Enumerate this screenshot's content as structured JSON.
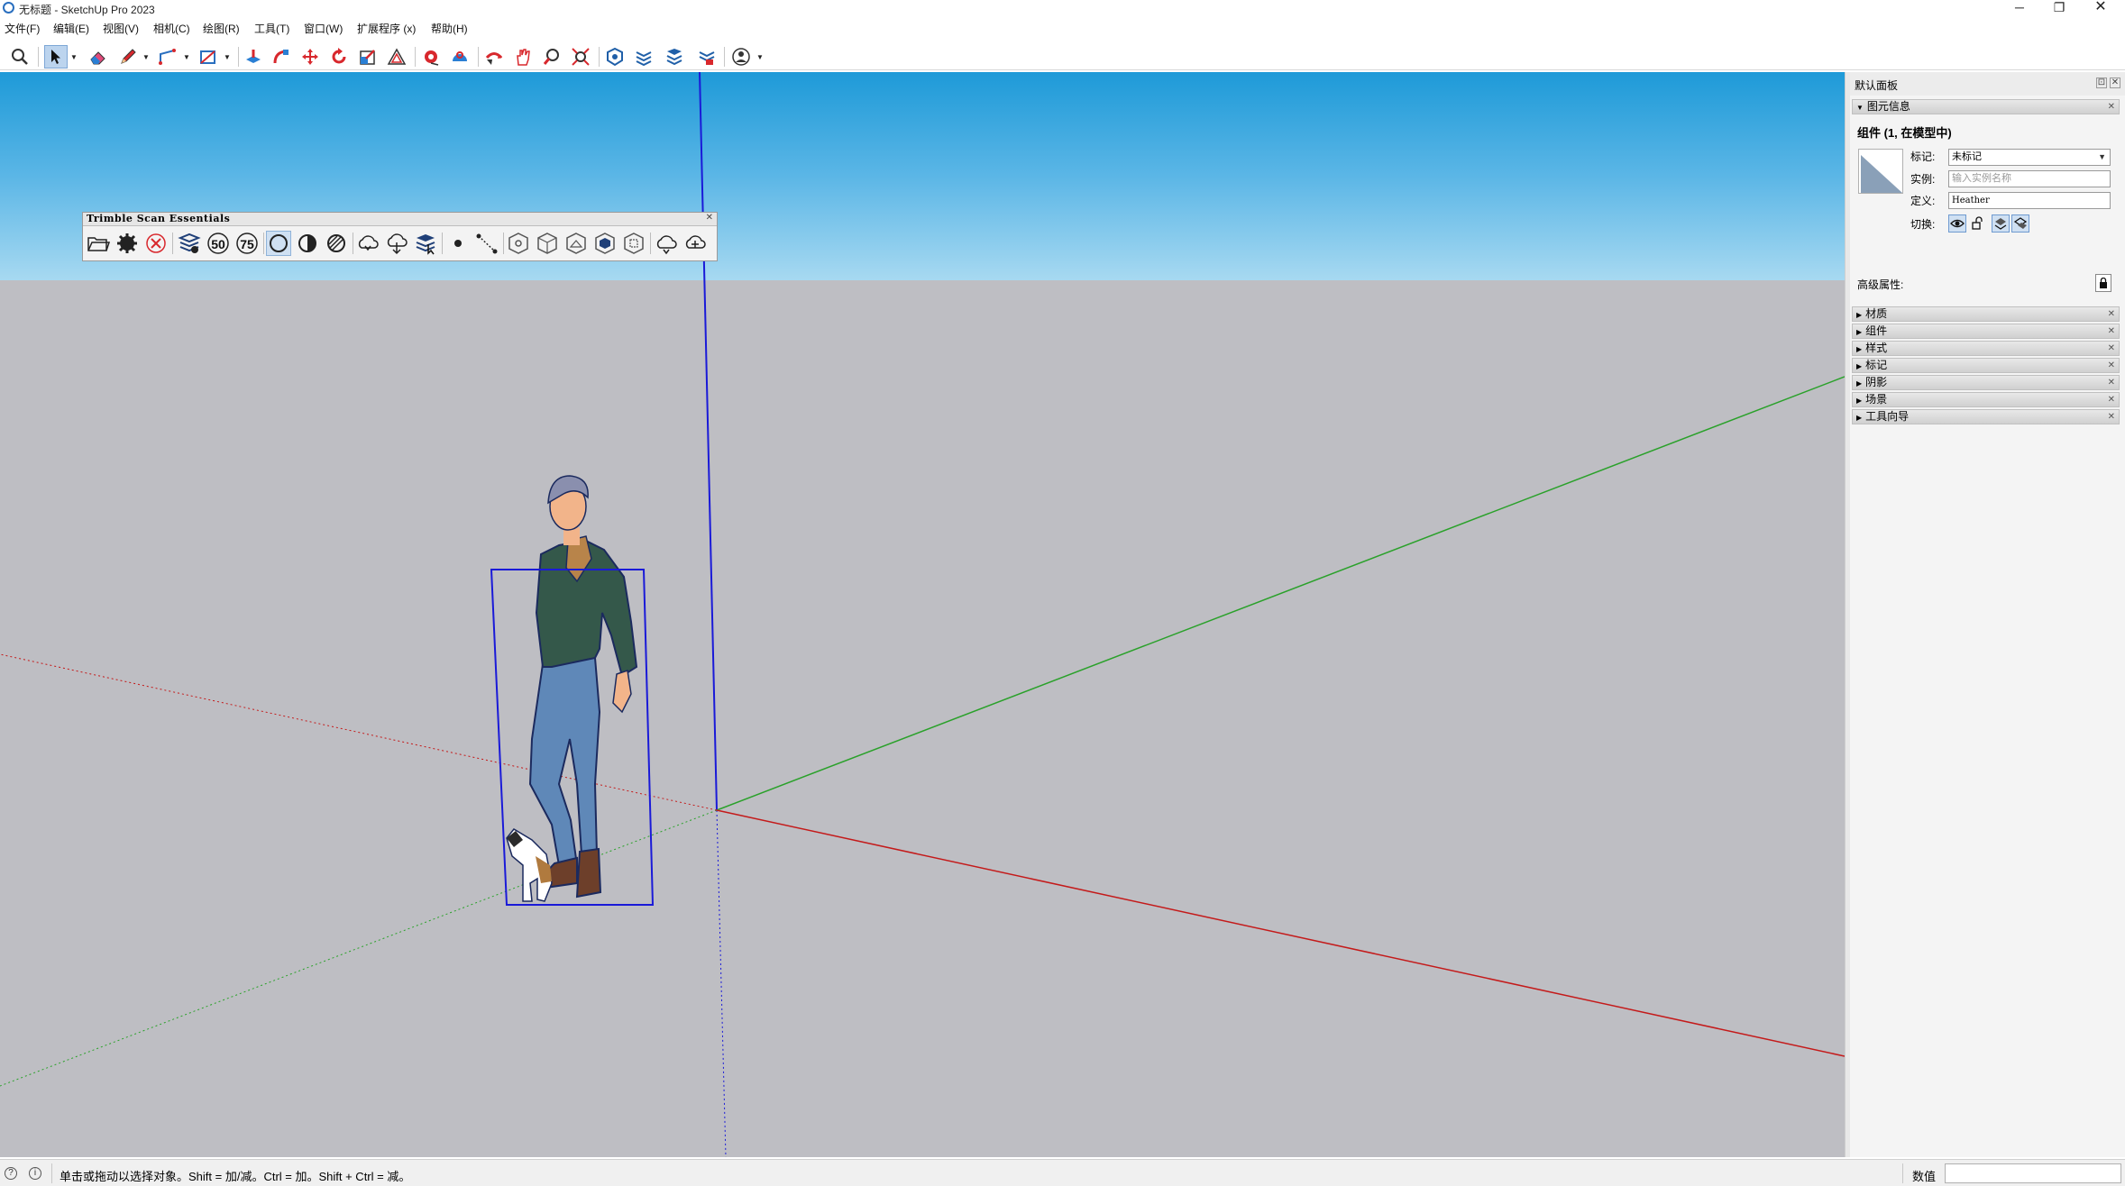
{
  "window": {
    "title": "无标题 - SketchUp Pro 2023",
    "minimize": "─",
    "restore": "❐",
    "close": "✕"
  },
  "menu": [
    "文件(F)",
    "编辑(E)",
    "视图(V)",
    "相机(C)",
    "绘图(R)",
    "工具(T)",
    "窗口(W)",
    "扩展程序 (x)",
    "帮助(H)"
  ],
  "toolbar": {
    "tools": [
      "search-icon",
      "select-icon",
      "eraser-icon",
      "pencil-icon",
      "line-icon",
      "rectangle-icon",
      "push-pull-icon",
      "follow-me-icon",
      "move-icon",
      "rotate-icon",
      "scale-icon",
      "offset-icon",
      "tape-measure-icon",
      "protractor-icon",
      "orbit-icon",
      "pan-icon",
      "zoom-icon",
      "zoom-extents-icon",
      "warehouse-icon",
      "extension-warehouse-icon",
      "layout-icon",
      "account-icon"
    ],
    "active": "select-icon"
  },
  "tse_toolbar": {
    "title": "Trimble Scan Essentials",
    "close": "✕",
    "buttons": [
      "open-folder-icon",
      "settings-gear-icon",
      "cancel-circle-icon",
      "layers-eye-icon",
      "percent-50-icon",
      "percent-75-icon",
      "ring-icon",
      "half-circle-icon",
      "hatched-circle-icon",
      "cloud-sync-icon",
      "cloud-download-icon",
      "scan-layers-icon",
      "point-icon",
      "line-points-icon",
      "hex-1-icon",
      "hex-2-icon",
      "hex-3-icon",
      "hex-4-icon",
      "hex-5-icon",
      "cloud-1-icon",
      "cloud-2-icon"
    ],
    "labels": {
      "p50": "50",
      "p75": "75"
    },
    "active": "ring-icon"
  },
  "model": {
    "figure": "Heather",
    "colors": {
      "sky_top": "#1e9ad8",
      "ground": "#bebec3",
      "blue_axis": "#1a1ad8",
      "green_axis": "#2aa12a",
      "red_axis": "#c41a1a",
      "selection": "#1a1ad8",
      "shirt": "#34584a",
      "jeans": "#5f88b8",
      "skin": "#f2b48a"
    }
  },
  "panel": {
    "title": "默认面板",
    "pin": "⊡",
    "close": "✕",
    "entity_info": {
      "tray_title": "图元信息",
      "heading": "组件 (1, 在模型中)",
      "tag_label": "标记:",
      "tag_value": "未标记",
      "instance_label": "实例:",
      "instance_placeholder": "输入实例名称",
      "definition_label": "定义:",
      "definition_value": "Heather",
      "toggles_label": "切换:",
      "advanced_label": "高级属性:"
    },
    "trays": [
      "材质",
      "组件",
      "样式",
      "标记",
      "阴影",
      "场景",
      "工具向导"
    ]
  },
  "status": {
    "message": "单击或拖动以选择对象。Shift = 加/减。Ctrl = 加。Shift + Ctrl = 减。",
    "measurements_label": "数值",
    "measurements_value": ""
  }
}
